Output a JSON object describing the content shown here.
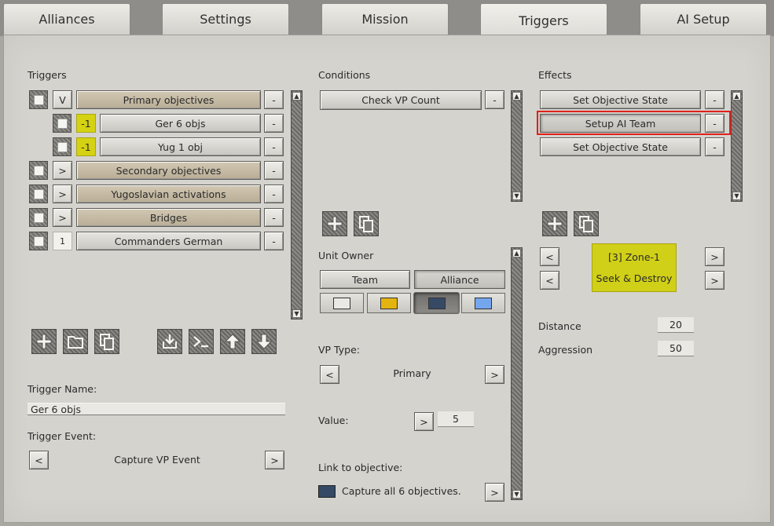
{
  "tabs": [
    {
      "label": "Alliances"
    },
    {
      "label": "Settings"
    },
    {
      "label": "Mission"
    },
    {
      "label": "Triggers",
      "active": true
    },
    {
      "label": "AI Setup"
    }
  ],
  "triggers": {
    "header": "Triggers",
    "rows": [
      {
        "badge": "V",
        "label": "Primary objectives",
        "remove": "-"
      },
      {
        "badge": "-1",
        "label": "Ger 6 objs",
        "remove": "-"
      },
      {
        "badge": "-1",
        "label": "Yug  1 obj",
        "remove": "-"
      },
      {
        "badge": ">",
        "label": "Secondary objectives",
        "remove": "-"
      },
      {
        "badge": ">",
        "label": "Yugoslavian activations",
        "remove": "-"
      },
      {
        "badge": ">",
        "label": "Bridges",
        "remove": "-"
      },
      {
        "badge": "1",
        "label": "Commanders German",
        "remove": "-"
      }
    ],
    "toolbar_icons": [
      "add-icon",
      "folder-icon",
      "copy-icon",
      "import-icon",
      "console-icon",
      "move-up-icon",
      "move-down-icon"
    ],
    "name_label": "Trigger Name:",
    "name_value": "Ger 6 objs",
    "event_label": "Trigger Event:",
    "event_value": "Capture VP Event",
    "prev": "<",
    "next": ">"
  },
  "conditions": {
    "header": "Conditions",
    "items": [
      {
        "label": "Check VP Count",
        "remove": "-"
      }
    ],
    "unit_owner_label": "Unit Owner",
    "team_label": "Team",
    "alliance_label": "Alliance",
    "swatches": [
      "#eae9e4",
      "#e3b40f",
      "#364a66",
      "#74a6ee"
    ],
    "vp_type_label": "VP Type:",
    "vp_type_value": "Primary",
    "value_label": "Value:",
    "value_value": "5",
    "link_label": "Link to objective:",
    "link_value": "Capture all 6 objectives.",
    "link_swatch": "#364a66",
    "prev": "<",
    "next": ">"
  },
  "effects": {
    "header": "Effects",
    "items": [
      {
        "label": "Set Objective State",
        "remove": "-"
      },
      {
        "label": "Setup AI Team",
        "remove": "-"
      },
      {
        "label": "Set Objective State",
        "remove": "-"
      }
    ],
    "zone_value": "[3] Zone-1",
    "order_value": "Seek & Destroy",
    "distance_label": "Distance",
    "distance_value": "20",
    "aggression_label": "Aggression",
    "aggression_value": "50",
    "prev": "<",
    "next": ">"
  },
  "colors": {
    "highlight_red": "#e0201a",
    "badge_yellow": "#d4d213",
    "tan_button": "#c7bca6"
  }
}
